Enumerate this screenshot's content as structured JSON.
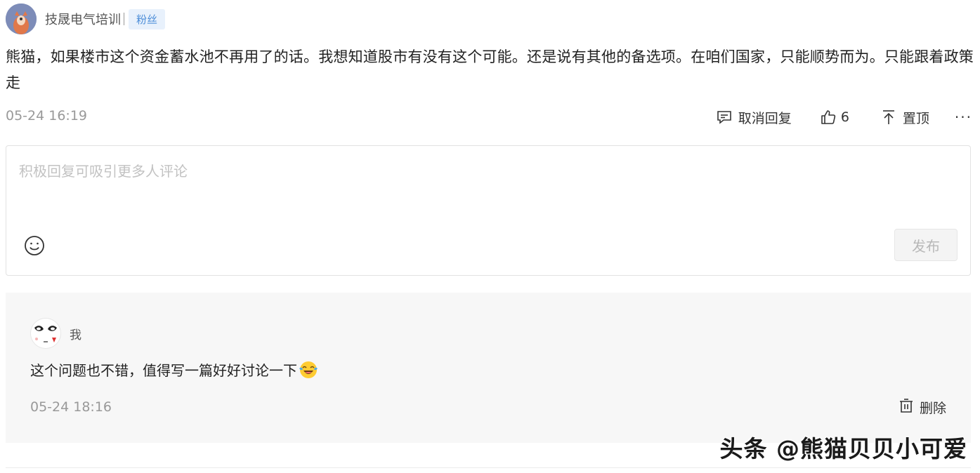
{
  "comment": {
    "author": "技晟电气培训",
    "badge": "粉丝",
    "text": "熊猫，如果楼市这个资金蓄水池不再用了的话。我想知道股市有没有这个可能。还是说有其他的备选项。在咱们国家，只能顺势而为。只能跟着政策走",
    "time": "05-24 16:19",
    "actions": {
      "reply_label": "取消回复",
      "like_count": "6",
      "pin_label": "置顶",
      "more_label": "···"
    }
  },
  "reply_box": {
    "placeholder": "积极回复可吸引更多人评论",
    "emoji_icon": "smiley-icon",
    "publish_label": "发布"
  },
  "sub_reply": {
    "author": "我",
    "text": "这个问题也不错，值得写一篇好好讨论一下",
    "emoji": "laughing-crying-icon",
    "time": "05-24 18:16",
    "delete_label": "删除"
  },
  "watermark": "头条 @熊猫贝贝小可爱",
  "colors": {
    "badge_bg": "#e8f1fc",
    "badge_text": "#4c8dd8",
    "muted_text": "#999999",
    "sub_reply_bg": "#f7f7f7"
  }
}
